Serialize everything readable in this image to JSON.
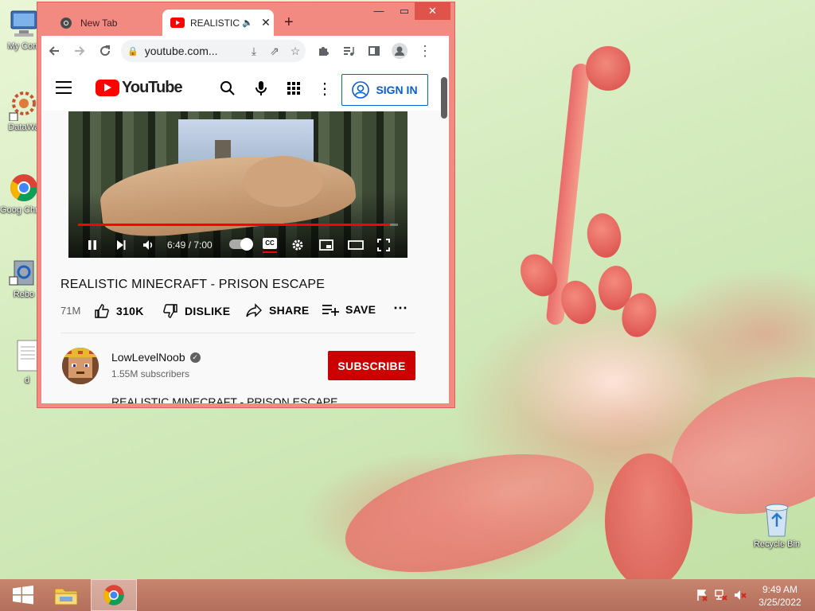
{
  "desktop": {
    "icons": [
      {
        "label": "My Com"
      },
      {
        "label": "DataWa"
      },
      {
        "label": "Goog Chron"
      },
      {
        "label": "Rebo"
      },
      {
        "label": "d"
      },
      {
        "label": "Recycle Bin"
      }
    ]
  },
  "browser": {
    "tabs": [
      {
        "title": "New Tab",
        "icon": "chrome-icon"
      },
      {
        "title": "REALISTIC",
        "icon": "youtube-icon",
        "audio": "speaker-icon"
      }
    ],
    "new_tab_symbol": "+",
    "address": "youtube.com...",
    "accent": "#f38a82"
  },
  "youtube": {
    "logo_text": "YouTube",
    "sign_in_label": "SIGN IN",
    "player": {
      "current_time": "6:49",
      "duration": "7:00",
      "time_label": "6:49 / 7:00",
      "progress_fraction": 0.975,
      "cc_label": "CC"
    },
    "video_title": "REALISTIC MINECRAFT - PRISON ESCAPE",
    "views": "71M",
    "actions": {
      "like_count": "310K",
      "dislike_label": "DISLIKE",
      "share_label": "SHARE",
      "save_label": "SAVE"
    },
    "channel": {
      "name": "LowLevelNoob",
      "subscribers": "1.55M subscribers",
      "subscribe_label": "SUBSCRIBE"
    },
    "description_peek": "REALISTIC MINECRAFT - PRISON ESCAPE",
    "colors": {
      "red": "#ff0000",
      "subscribe": "#cc0000",
      "link_blue": "#065fd4"
    }
  },
  "taskbar": {
    "time": "9:49 AM",
    "date": "3/25/2022"
  }
}
